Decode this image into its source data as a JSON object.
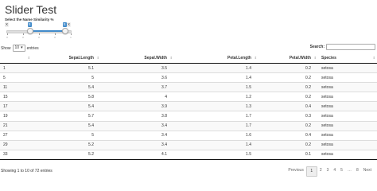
{
  "app": {
    "title": "Slider Test"
  },
  "slider": {
    "label": "Select the Name Similarity %",
    "min_tag": "X",
    "max_tag": "X",
    "from_tag": "S",
    "to_tag": "S",
    "from": 0.35,
    "to": 0.9,
    "tick_labels": [
      "0",
      "0",
      "0",
      "0",
      "1"
    ]
  },
  "length": {
    "prefix": "Show",
    "value": "10",
    "suffix": "entries"
  },
  "search": {
    "label": "Search:",
    "value": ""
  },
  "table": {
    "columns": [
      "",
      "Sepal.Length",
      "Sepal.Width",
      "Petal.Length",
      "Petal.Width",
      "Species"
    ],
    "rows": [
      [
        "1",
        "5.1",
        "3.5",
        "1.4",
        "0.2",
        "setosa"
      ],
      [
        "5",
        "5",
        "3.6",
        "1.4",
        "0.2",
        "setosa"
      ],
      [
        "11",
        "5.4",
        "3.7",
        "1.5",
        "0.2",
        "setosa"
      ],
      [
        "15",
        "5.8",
        "4",
        "1.2",
        "0.2",
        "setosa"
      ],
      [
        "17",
        "5.4",
        "3.9",
        "1.3",
        "0.4",
        "setosa"
      ],
      [
        "19",
        "5.7",
        "3.8",
        "1.7",
        "0.3",
        "setosa"
      ],
      [
        "21",
        "5.4",
        "3.4",
        "1.7",
        "0.2",
        "setosa"
      ],
      [
        "27",
        "5",
        "3.4",
        "1.6",
        "0.4",
        "setosa"
      ],
      [
        "29",
        "5.2",
        "3.4",
        "1.4",
        "0.2",
        "setosa"
      ],
      [
        "33",
        "5.2",
        "4.1",
        "1.5",
        "0.1",
        "setosa"
      ]
    ]
  },
  "info": "Showing 1 to 10 of 72 entries",
  "pagination": {
    "previous": "Previous",
    "pages": [
      "1",
      "2",
      "3",
      "4",
      "5",
      "…",
      "8"
    ],
    "current": "1",
    "next": "Next"
  },
  "colors": {
    "accent": "#428bca",
    "stripe": "#f9f9f9"
  }
}
